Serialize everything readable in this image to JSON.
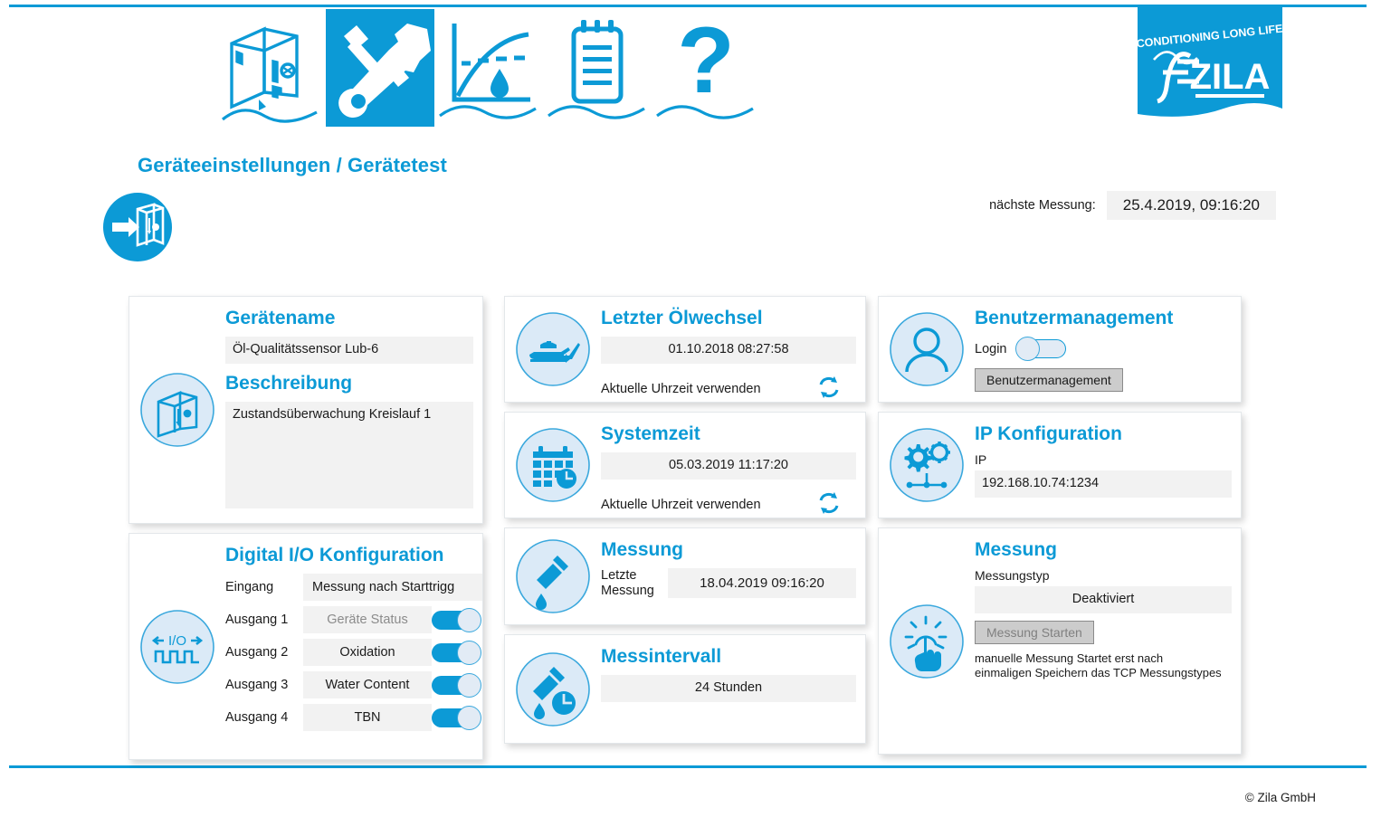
{
  "brand": {
    "accent": "#0c9ad6",
    "field_bg": "#f2f2f2",
    "logo_tagline": "CONDITIONING LONG LIFE",
    "logo_name": "ZILA"
  },
  "nav": {
    "items": [
      {
        "icon": "device-icon",
        "label": "Gerät",
        "active": false
      },
      {
        "icon": "tools-icon",
        "label": "Geräteeinstellungen",
        "active": true
      },
      {
        "icon": "chart-droplet-icon",
        "label": "Messwerte",
        "active": false
      },
      {
        "icon": "clipboard-icon",
        "label": "Protokoll",
        "active": false
      },
      {
        "icon": "question-mark-icon",
        "label": "Hilfe",
        "active": false
      }
    ]
  },
  "header": {
    "page_title": "Geräteeinstellungen / Gerätetest",
    "page_icon": "device-arrow-icon",
    "next_measurement_label": "nächste Messung:",
    "next_measurement_value": "25.4.2019, 09:16:20"
  },
  "cards": {
    "device_name": {
      "icon": "device-box-icon",
      "title": "Gerätename",
      "name_value": "Öl-Qualitätssensor Lub-6",
      "description_title": "Beschreibung",
      "description_value": "Zustandsüberwachung Kreislauf 1"
    },
    "digital_io": {
      "icon": "io-signal-icon",
      "title": "Digital I/O Konfiguration",
      "rows": [
        {
          "label": "Eingang",
          "value": "Messung nach Starttrigg",
          "has_toggle": false,
          "toggle_on": false,
          "muted": false,
          "align": "left"
        },
        {
          "label": "Ausgang 1",
          "value": "Geräte Status",
          "has_toggle": true,
          "toggle_on": true,
          "muted": true,
          "align": "center"
        },
        {
          "label": "Ausgang 2",
          "value": "Oxidation",
          "has_toggle": true,
          "toggle_on": true,
          "muted": false,
          "align": "center"
        },
        {
          "label": "Ausgang 3",
          "value": "Water Content",
          "has_toggle": true,
          "toggle_on": true,
          "muted": false,
          "align": "center"
        },
        {
          "label": "Ausgang 4",
          "value": "TBN",
          "has_toggle": true,
          "toggle_on": true,
          "muted": false,
          "align": "center"
        }
      ]
    },
    "last_oil_change": {
      "icon": "oil-can-icon",
      "title": "Letzter Ölwechsel",
      "value": "01.10.2018 08:27:58",
      "use_current_time_label": "Aktuelle Uhrzeit verwenden",
      "refresh_icon": "refresh-icon"
    },
    "system_time": {
      "icon": "calendar-clock-icon",
      "title": "Systemzeit",
      "value": "05.03.2019 11:17:20",
      "use_current_time_label": "Aktuelle Uhrzeit verwenden",
      "refresh_icon": "refresh-icon"
    },
    "measurement_last": {
      "icon": "pipette-icon",
      "title": "Messung",
      "last_label": "Letzte Messung",
      "last_value": "18.04.2019 09:16:20"
    },
    "measurement_interval": {
      "icon": "pipette-clock-icon",
      "title": "Messintervall",
      "value": "24 Stunden"
    },
    "user_management": {
      "icon": "user-icon",
      "title": "Benutzermanagement",
      "login_label": "Login",
      "login_toggle_on": false,
      "button_label": "Benutzermanagement"
    },
    "ip_config": {
      "icon": "gears-network-icon",
      "title": "IP Konfiguration",
      "ip_label": "IP",
      "ip_value": "192.168.10.74:1234"
    },
    "measurement_start": {
      "icon": "hand-press-icon",
      "title": "Messung",
      "type_label": "Messungstyp",
      "type_value": "Deaktiviert",
      "start_button_label": "Messung Starten",
      "hint_line_1": "manuelle Messung Startet erst nach",
      "hint_line_2": "einmaligen Speichern das TCP Messungstypes"
    }
  },
  "footer": {
    "copyright": "© Zila GmbH"
  }
}
